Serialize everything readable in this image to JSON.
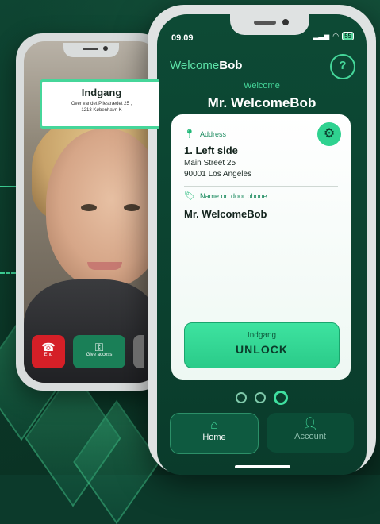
{
  "colors": {
    "accent": "#3fe0a0",
    "background": "#0c3a2b",
    "card": "#ffffff",
    "end": "#d51f27"
  },
  "back_phone": {
    "door_title": "Indgang",
    "door_address_line1": "Over vandet Pilestrædet 25 ,",
    "door_address_line2": "1213 København K",
    "end_label": "End",
    "give_access_label": "Give access",
    "icons": {
      "end": "phone-hangup-icon",
      "give_access": "key-icon"
    }
  },
  "status_bar": {
    "time": "09.09",
    "battery": "55"
  },
  "header": {
    "brand_prefix": "Welcome",
    "brand_suffix": "Bob",
    "help": "?"
  },
  "welcome": {
    "label": "Welcome",
    "name": "Mr. WelcomeBob"
  },
  "card": {
    "address_label": "Address",
    "address_name": "1. Left side",
    "address_street": "Main Street 25",
    "address_city": "90001 Los Angeles",
    "door_phone_label": "Name on door phone",
    "door_phone_name": "Mr. WelcomeBob",
    "unlock_sub": "Indgang",
    "unlock_main": "UNLOCK"
  },
  "pager": {
    "count": 3,
    "active_index": 2
  },
  "nav": {
    "home": "Home",
    "account": "Account"
  }
}
